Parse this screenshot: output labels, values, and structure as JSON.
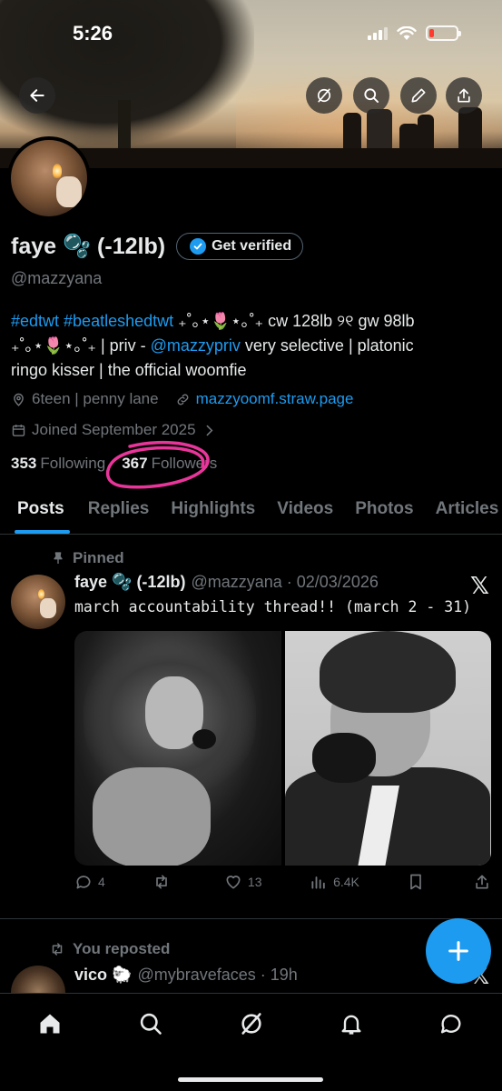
{
  "status_bar": {
    "time": "5:26"
  },
  "profile": {
    "display_name": "faye 🫧 (-12lb)",
    "verify_button": "Get verified",
    "handle": "@mazzyana",
    "bio_tags": "#edtwt #beatleshedtwt",
    "bio_line1_rest": " ₊˚｡⋆🌷⋆｡˚₊ cw 128lb ୨୧ gw 98lb",
    "bio_line2_start": "₊˚｡⋆🌷⋆｡˚₊ | priv - ",
    "bio_mention": "@mazzypriv",
    "bio_line2_end": " very selective | platonic",
    "bio_line3": "ringo kisser | the official woomfie",
    "location": "6teen | penny lane",
    "website": "mazzyoomf.straw.page",
    "joined": "Joined September 2025",
    "following_count": "353",
    "following_label": "Following",
    "followers_count": "367",
    "followers_label": "Followers"
  },
  "tabs": [
    "Posts",
    "Replies",
    "Highlights",
    "Videos",
    "Photos",
    "Articles"
  ],
  "active_tab": "Posts",
  "pinned_post": {
    "pinned_label": "Pinned",
    "author": "faye 🫧 (-12lb)",
    "handle_date": "@mazzyana · 02/03/2026",
    "text": "march accountability thread!! (march 2 - 31)",
    "replies": "4",
    "reposts": "",
    "likes": "13",
    "views": "6.4K"
  },
  "second_post": {
    "repost_label": "You reposted",
    "author": "vico 🐑",
    "handle_time": "@mybravefaces · 19h"
  },
  "colors": {
    "accent": "#1d9bf0",
    "annotation": "#e8359a"
  }
}
